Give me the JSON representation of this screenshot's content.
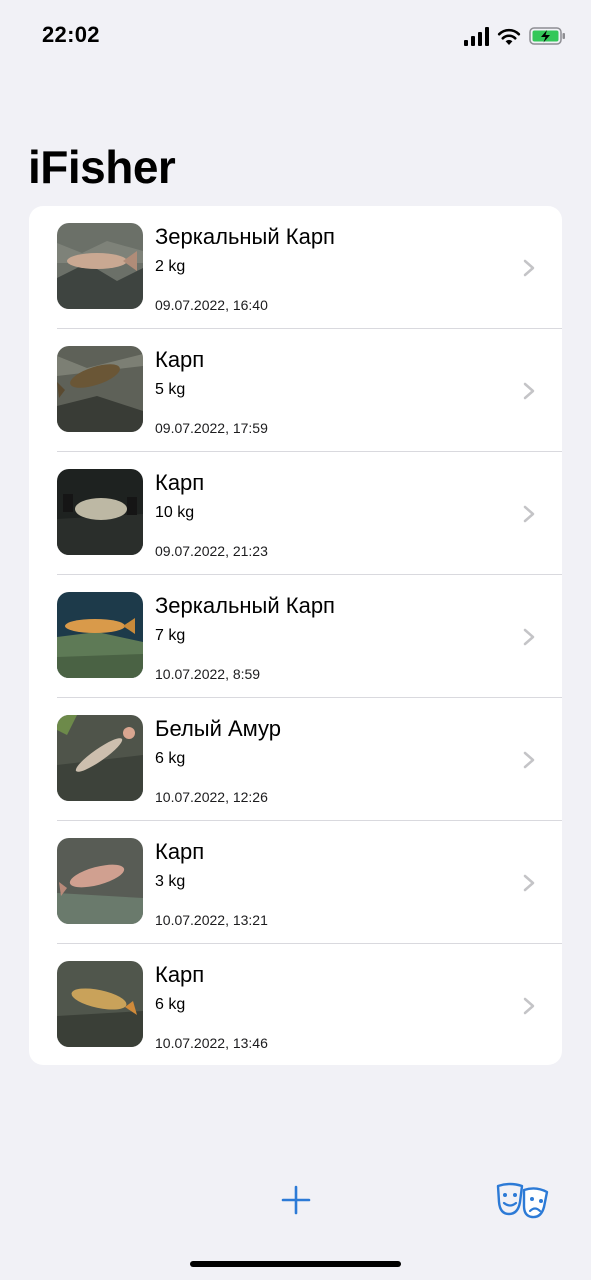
{
  "status_bar": {
    "time": "22:02"
  },
  "app": {
    "title": "iFisher"
  },
  "catches": [
    {
      "species": "Зеркальный Карп",
      "weight": "2 kg",
      "date": "09.07.2022, 16:40"
    },
    {
      "species": "Карп",
      "weight": "5 kg",
      "date": "09.07.2022, 17:59"
    },
    {
      "species": "Карп",
      "weight": "10 kg",
      "date": "09.07.2022, 21:23"
    },
    {
      "species": "Зеркальный Карп",
      "weight": "7 kg",
      "date": "10.07.2022, 8:59"
    },
    {
      "species": "Белый Амур",
      "weight": "6 kg",
      "date": "10.07.2022, 12:26"
    },
    {
      "species": "Карп",
      "weight": "3 kg",
      "date": "10.07.2022, 13:21"
    },
    {
      "species": "Карп",
      "weight": "6 kg",
      "date": "10.07.2022, 13:46"
    }
  ],
  "icons": {
    "row_thumbnail": "fish-photo-icon",
    "row_chevron": "chevron-right-icon",
    "add": "plus-icon",
    "mode": "theater-masks-icon"
  },
  "colors": {
    "accent": "#2c7ad6",
    "background": "#f1f1f6",
    "card": "#ffffff",
    "chevron": "#c4c4c7"
  }
}
